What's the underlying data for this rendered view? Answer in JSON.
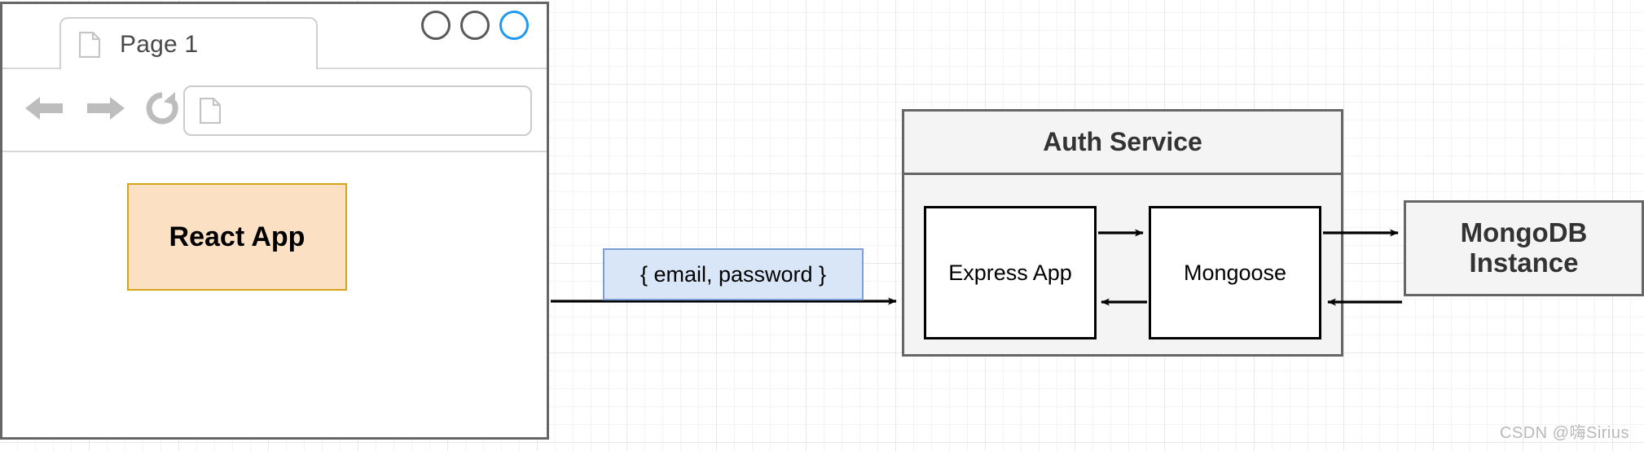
{
  "browser": {
    "tab": {
      "label": "Page 1",
      "icon": "document-icon"
    },
    "window_controls": [
      {
        "name": "window-circle-1",
        "color": "#595959"
      },
      {
        "name": "window-circle-2",
        "color": "#595959"
      },
      {
        "name": "window-circle-3",
        "color": "#1e9bf0"
      }
    ],
    "toolbar": {
      "back_icon": "arrow-left-icon",
      "forward_icon": "arrow-right-icon",
      "reload_icon": "reload-icon",
      "address_icon": "document-icon",
      "address_value": "",
      "address_placeholder": ""
    },
    "content": {
      "react_app_label": "React App"
    }
  },
  "diagram": {
    "auth_service": {
      "title": "Auth Service",
      "children": [
        {
          "label": "Express App"
        },
        {
          "label": "Mongoose"
        }
      ]
    },
    "mongodb": {
      "line1": "MongoDB",
      "line2": "Instance"
    },
    "payload_label": "{ email, password }"
  },
  "colors": {
    "react_app_fill": "#fbe0c3",
    "react_app_border": "#d6a416",
    "payload_fill": "#d9e6f8",
    "payload_border": "#7b9ed4",
    "container_fill": "#f4f4f4",
    "container_border": "#666666",
    "accent_circle": "#1e9bf0",
    "grid_minor": "#f4f4f4",
    "grid_major": "#e8e8e8"
  },
  "watermark": "CSDN @嗨Sirius"
}
